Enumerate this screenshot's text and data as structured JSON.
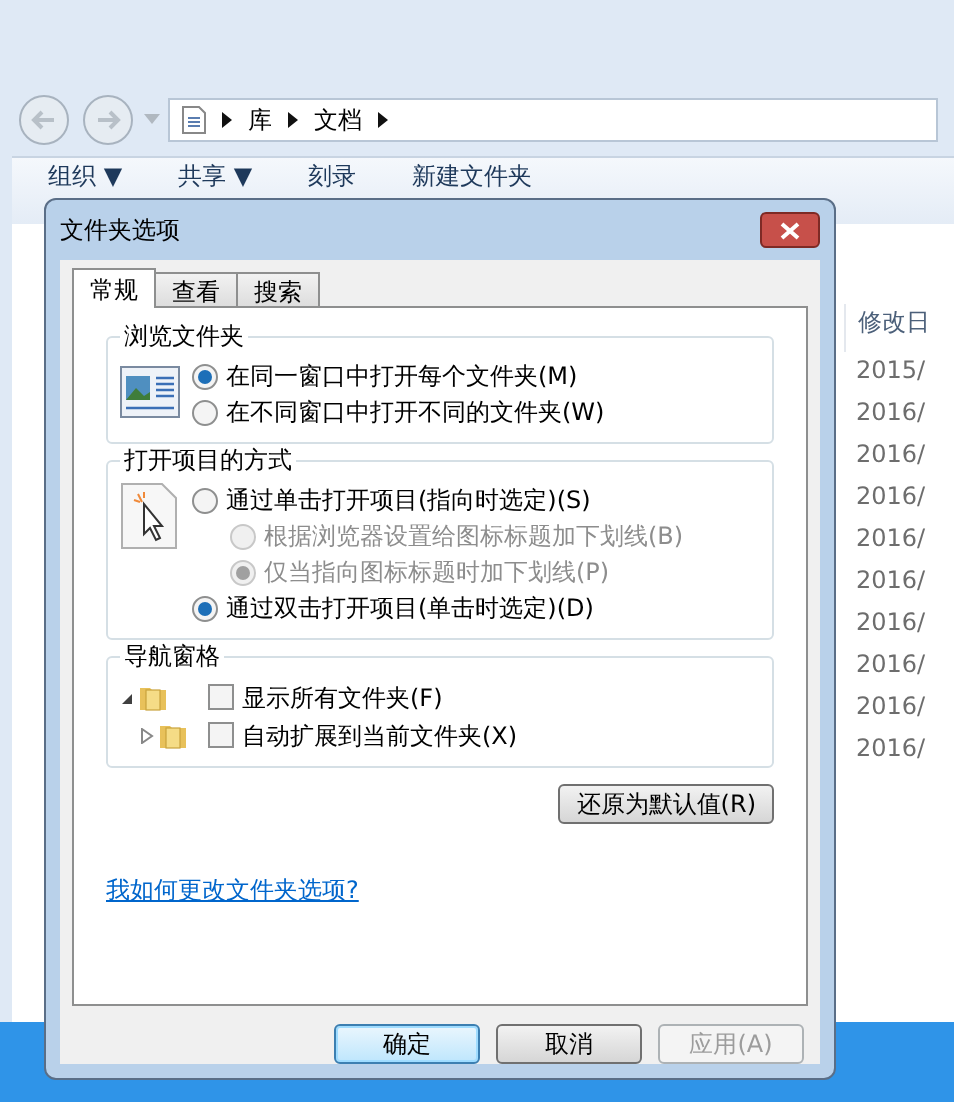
{
  "explorer": {
    "breadcrumb": [
      "库",
      "文档"
    ],
    "toolbar": [
      "组织 ▼",
      "共享 ▼",
      "刻录",
      "新建文件夹"
    ],
    "column_header": "修改日",
    "dates": [
      "2015/",
      "2016/",
      "2016/",
      "2016/",
      "2016/",
      "2016/",
      "2016/",
      "2016/",
      "2016/",
      "2016/"
    ]
  },
  "dialog": {
    "title": "文件夹选项",
    "tabs": [
      {
        "label": "常规",
        "selected": true
      },
      {
        "label": "查看",
        "selected": false
      },
      {
        "label": "搜索",
        "selected": false
      }
    ],
    "groups": [
      {
        "kind": "radio",
        "title": "浏览文件夹",
        "options": [
          {
            "label": "在同一窗口中打开每个文件夹(M)",
            "selected": true,
            "disabled": false
          },
          {
            "label": "在不同窗口中打开不同的文件夹(W)",
            "selected": false,
            "disabled": false
          }
        ]
      },
      {
        "kind": "radio",
        "title": "打开项目的方式",
        "options": [
          {
            "label": "通过单击打开项目(指向时选定)(S)",
            "selected": false,
            "disabled": false,
            "children": [
              {
                "label": "根据浏览器设置给图标标题加下划线(B)",
                "selected": false,
                "disabled": true
              },
              {
                "label": "仅当指向图标标题时加下划线(P)",
                "selected": true,
                "disabled": true
              }
            ]
          },
          {
            "label": "通过双击打开项目(单击时选定)(D)",
            "selected": true,
            "disabled": false
          }
        ]
      },
      {
        "kind": "tree",
        "title": "导航窗格",
        "options": [
          {
            "label": "显示所有文件夹(F)",
            "checked": false,
            "expanded": true
          },
          {
            "label": "自动扩展到当前文件夹(X)",
            "checked": false,
            "expanded": false
          }
        ]
      }
    ],
    "restore_button": "还原为默认值(R)",
    "help_link": "我如何更改文件夹选项?",
    "buttons": [
      {
        "label": "确定",
        "disabled": false,
        "default": true
      },
      {
        "label": "取消",
        "disabled": false,
        "default": false
      },
      {
        "label": "应用(A)",
        "disabled": true,
        "default": false
      }
    ]
  }
}
